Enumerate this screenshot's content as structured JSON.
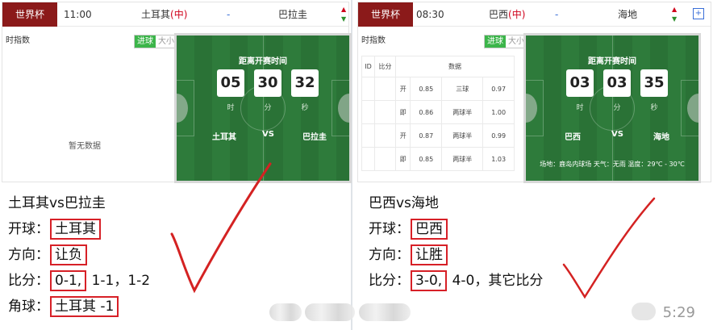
{
  "left": {
    "match": {
      "league": "世界杯",
      "time": "11:00",
      "home": "土耳其",
      "home_tag": "(中)",
      "dash": "-",
      "away": "巴拉圭"
    },
    "index_title": "时指数",
    "toggle": {
      "on": "进球",
      "off": "大小"
    },
    "no_data": "暂无数据",
    "countdown": {
      "title": "距离开赛时间",
      "hours": "05",
      "minutes": "30",
      "seconds": "32",
      "unit_h": "时",
      "unit_m": "分",
      "unit_s": "秒",
      "home": "土耳其",
      "vs": "VS",
      "away": "巴拉圭"
    },
    "prediction": {
      "title": "土耳其vs巴拉圭",
      "kickoff_label": "开球：",
      "kickoff_value": "土耳其",
      "direction_label": "方向：",
      "direction_value": "让负",
      "score_label": "比分：",
      "score_main": "0-1,",
      "score_rest": " 1-1，1-2",
      "corner_label": "角球：",
      "corner_value": "土耳其 -1"
    }
  },
  "right": {
    "match": {
      "league": "世界杯",
      "time": "08:30",
      "home": "巴西",
      "home_tag": "(中)",
      "dash": "-",
      "away": "海地"
    },
    "index_title": "时指数",
    "toggle": {
      "on": "进球",
      "off": "大小"
    },
    "table": {
      "headers": [
        "ID",
        "比分",
        "数据"
      ],
      "rows": [
        {
          "type": "开",
          "a": "0.85",
          "line": "三球",
          "b": "0.97"
        },
        {
          "type": "即",
          "a": "0.86",
          "line": "两球半",
          "b": "1.00"
        },
        {
          "type": "开",
          "a": "0.87",
          "line": "两球半",
          "b": "0.99"
        },
        {
          "type": "即",
          "a": "0.85",
          "line": "两球半",
          "b": "1.03"
        }
      ]
    },
    "countdown": {
      "title": "距离开赛时间",
      "hours": "03",
      "minutes": "03",
      "seconds": "35",
      "unit_h": "时",
      "unit_m": "分",
      "unit_s": "秒",
      "home": "巴西",
      "vs": "VS",
      "away": "海地",
      "venue": "场地：鹿岛内球场 天气：无雨 温度：29℃ - 30℃"
    },
    "prediction": {
      "title": "巴西vs海地",
      "kickoff_label": "开球：",
      "kickoff_value": "巴西",
      "direction_label": "方向：",
      "direction_value": "让胜",
      "score_label": "比分：",
      "score_main": "3-0,",
      "score_rest": " 4-0，其它比分"
    }
  },
  "footer": {
    "time": "5:29"
  },
  "colors": {
    "league_bg": "#8b1a1a",
    "field": "#2e7b3b",
    "highlight": "#d72027",
    "check": "#d42222"
  }
}
